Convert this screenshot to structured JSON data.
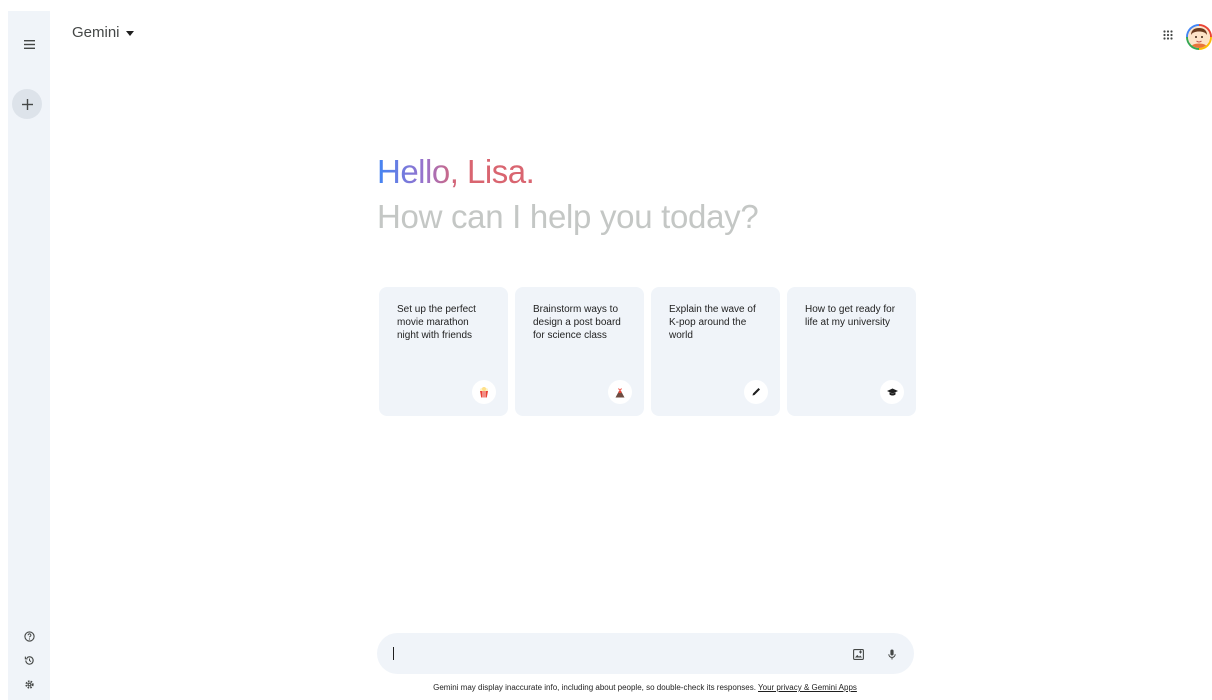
{
  "header": {
    "app_title": "Gemini"
  },
  "sidebar": {
    "icons": [
      "menu-icon",
      "plus-icon",
      "help-icon",
      "history-icon",
      "settings-icon"
    ]
  },
  "greeting": {
    "hello": "Hello,",
    "name": "Lisa.",
    "subtitle": "How can I help you today?"
  },
  "suggestions": [
    {
      "text": "Set up the perfect movie marathon night with friends",
      "icon": "popcorn-icon"
    },
    {
      "text": "Brainstorm ways to design a post board for science class",
      "icon": "volcano-icon"
    },
    {
      "text": "Explain the wave of K-pop around the world",
      "icon": "pen-icon"
    },
    {
      "text": "How to get ready for life at my university",
      "icon": "graduation-cap-icon"
    }
  ],
  "input": {
    "placeholder": "",
    "value": ""
  },
  "footer": {
    "disclaimer": "Gemini may display inaccurate info, including about people, so double-check its responses.",
    "link": "Your privacy & Gemini Apps"
  },
  "colors": {
    "rail_bg": "#f0f4f9",
    "card_bg": "#f0f4f9",
    "gradient_blue": "#4285f4",
    "gradient_pink": "#d96570",
    "subtitle": "#c4c7c5"
  }
}
